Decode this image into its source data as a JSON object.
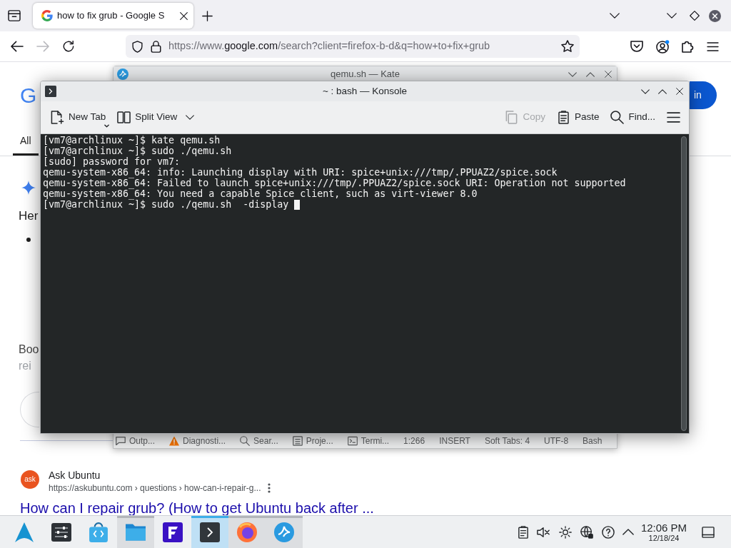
{
  "browser": {
    "tabs": [
      {
        "title": "how to fix grub - Google S",
        "selected": true
      }
    ],
    "nav_buttons": [
      {
        "kind": "back",
        "disabled": false
      },
      {
        "kind": "forward",
        "disabled": true
      },
      {
        "kind": "reload",
        "disabled": false
      }
    ],
    "address": {
      "prefix": "https://www.",
      "domain": "google.com",
      "rest": "/search?client=firefox-b-d&q=how+to+fix+grub"
    }
  },
  "google_page": {
    "logo": "G",
    "sign_in_button": "in",
    "tabs": [
      {
        "label": "All",
        "selected": true
      }
    ],
    "overview": {
      "heading": "Her",
      "text_1": "Boo",
      "text_2": "rei"
    },
    "result": {
      "logo": "ask",
      "site": "Ask Ubuntu",
      "url": "https://askubuntu.com › questions › how-can-i-repair-g...",
      "title": "How can I repair grub? (How to get Ubuntu back after ..."
    }
  },
  "kate_window": {
    "title": "qemu.sh — Kate",
    "status_bar": [
      {
        "kind": "output",
        "label": "Outp..."
      },
      {
        "kind": "diagnostics",
        "label": "Diagnosti..."
      },
      {
        "kind": "search",
        "label": "Sear..."
      },
      {
        "kind": "projects",
        "label": "Proje..."
      },
      {
        "kind": "terminal",
        "label": "Termi..."
      },
      {
        "kind": "info",
        "label": "1:266"
      },
      {
        "kind": "info",
        "label": "INSERT"
      },
      {
        "kind": "info",
        "label": "Soft Tabs: 4"
      },
      {
        "kind": "info",
        "label": "UTF-8"
      },
      {
        "kind": "info",
        "label": "Bash"
      }
    ]
  },
  "konsole_window": {
    "title": "~ : bash — Konsole",
    "toolbar_left": [
      {
        "kind": "new_tab",
        "label": "New Tab",
        "disabled": false
      },
      {
        "kind": "split_view",
        "label": "Split View",
        "disabled": false
      }
    ],
    "toolbar_right": [
      {
        "kind": "copy",
        "label": "Copy",
        "disabled": true
      },
      {
        "kind": "paste",
        "label": "Paste",
        "disabled": false
      },
      {
        "kind": "find",
        "label": "Find...",
        "disabled": false
      },
      {
        "kind": "menu",
        "disabled": false
      }
    ],
    "terminal": {
      "lines": [
        "[vm7@archlinux ~]$ kate qemu.sh",
        "[vm7@archlinux ~]$ sudo ./qemu.sh",
        "[sudo] password for vm7:",
        "qemu-system-x86_64: info: Launching display with URI: spice+unix:///tmp/.PPUAZ2/spice.sock",
        "qemu-system-x86_64: Failed to launch spice+unix:///tmp/.PPUAZ2/spice.sock URI: Operation not supported",
        "qemu-system-x86_64: You need a capable Spice client, such as virt-viewer 8.0",
        "[vm7@archlinux ~]$ sudo ./qemu.sh  -display "
      ],
      "cursor_visible": true
    }
  },
  "taskbar": {
    "apps": [
      {
        "kind": "launcher",
        "running": false,
        "selected": false
      },
      {
        "kind": "settings",
        "running": false,
        "selected": false
      },
      {
        "kind": "store",
        "running": false,
        "selected": false
      },
      {
        "kind": "files",
        "running": true,
        "selected": false
      },
      {
        "kind": "f_app",
        "running": false,
        "selected": false
      },
      {
        "kind": "terminal",
        "running": true,
        "selected": true
      },
      {
        "kind": "browser",
        "running": true,
        "selected": false
      },
      {
        "kind": "editor",
        "running": true,
        "selected": false
      }
    ],
    "volume": {
      "muted": true
    },
    "clock": {
      "time": "12:06 PM",
      "date": "12/18/24"
    }
  }
}
